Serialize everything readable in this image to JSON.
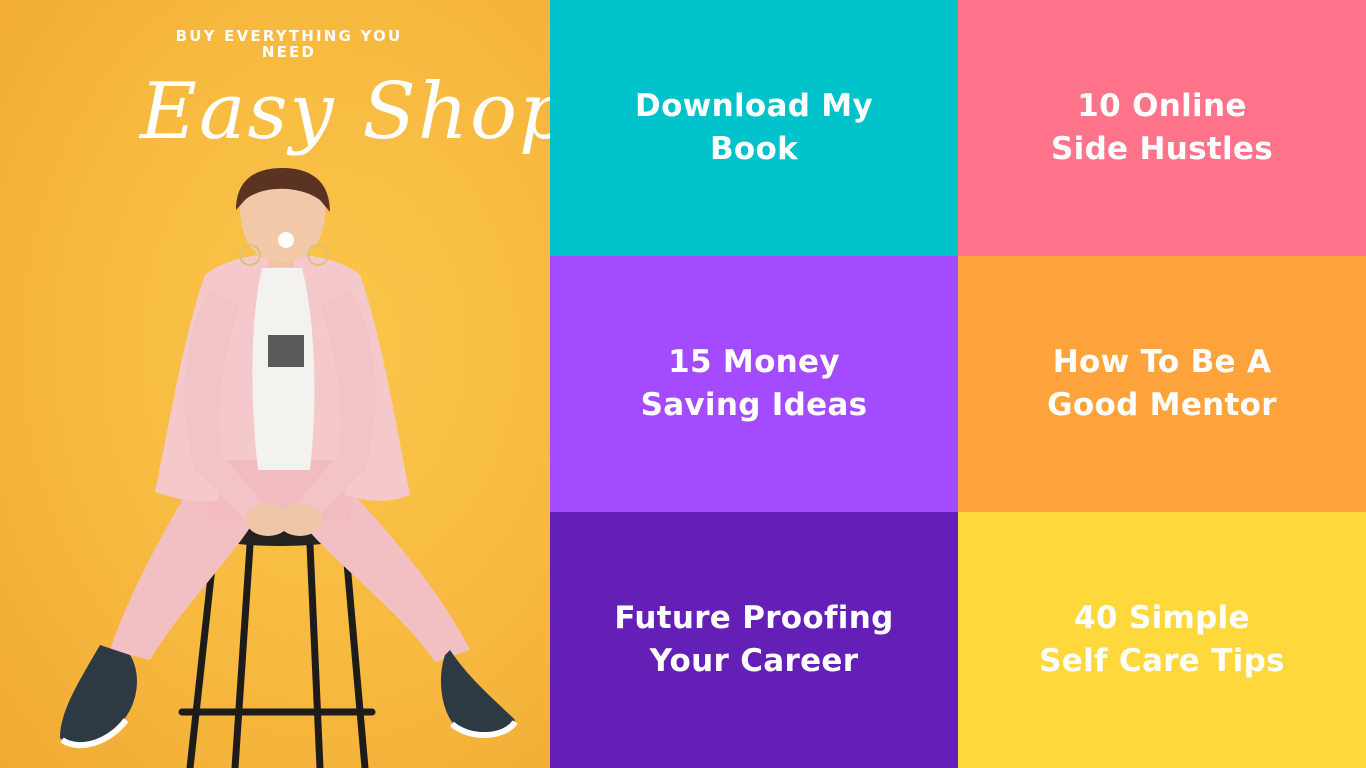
{
  "hero": {
    "tagline": "BUY EVERYTHING YOU NEED",
    "brand": "Easy Shop",
    "photo": "woman-in-pink-suit-on-bar-stool"
  },
  "tiles": [
    {
      "label": "Download My\nBook",
      "color": "#00c2cb"
    },
    {
      "label": "10 Online\nSide Hustles",
      "color": "#ff738b"
    },
    {
      "label": "15 Money\nSaving Ideas",
      "color": "#a54bff"
    },
    {
      "label": "How To Be A\nGood Mentor",
      "color": "#ffa43d"
    },
    {
      "label": "Future Proofing\nYour Career",
      "color": "#6420b6"
    },
    {
      "label": "40 Simple\nSelf Care Tips",
      "color": "#ffd83c"
    }
  ]
}
